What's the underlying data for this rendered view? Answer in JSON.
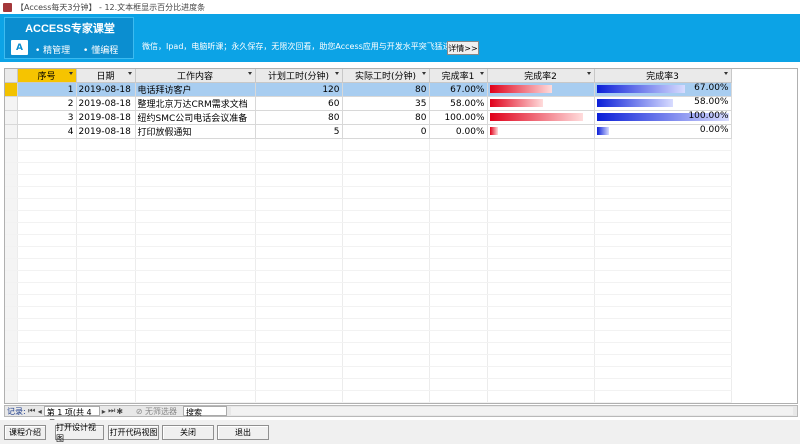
{
  "window": {
    "title": "【Access每天3分钟】 - 12.文本框显示百分比进度条"
  },
  "banner": {
    "brand_title": "ACCESS专家课堂",
    "logo_text": "A",
    "nav": [
      "• 精管理",
      "• 懂编程"
    ],
    "promo": "微信，Ipad，电脑听课；永久保存，无限次回看，助您Access应用与开发水平突飞猛进!",
    "details_label": "详情>>"
  },
  "table": {
    "columns": [
      "序号",
      "日期",
      "工作内容",
      "计划工时(分钟)",
      "实际工时(分钟)",
      "完成率1",
      "完成率2",
      "完成率3"
    ],
    "rows": [
      {
        "id": "1",
        "date": "2019-08-18",
        "task": "电话拜访客户",
        "planned": "120",
        "actual": "80",
        "rate": "67.00%",
        "fraction": 0.67,
        "current": true
      },
      {
        "id": "2",
        "date": "2019-08-18",
        "task": "整理北京万达CRM需求文档",
        "planned": "60",
        "actual": "35",
        "rate": "58.00%",
        "fraction": 0.58,
        "current": false
      },
      {
        "id": "3",
        "date": "2019-08-18",
        "task": "纽约SMC公司电话会议准备",
        "planned": "80",
        "actual": "80",
        "rate": "100.00%",
        "fraction": 1.0,
        "current": false
      },
      {
        "id": "4",
        "date": "2019-08-18",
        "task": "打印放假通知",
        "planned": "5",
        "actual": "0",
        "rate": "0.00%",
        "fraction": 0.0,
        "current": false
      }
    ]
  },
  "navigation": {
    "record_label": "记录:",
    "position": "第 1 项(共 4 项)",
    "filter": "无筛选器",
    "search_placeholder": "搜索"
  },
  "buttons": [
    "课程介绍",
    "打开设计视图",
    "打开代码视图",
    "关闭",
    "退出"
  ],
  "colors": {
    "banner": "#0ca3e6",
    "bar_red": "#e0001a",
    "bar_blue": "#0b1fd8",
    "current_row": "#a8cdf0"
  }
}
